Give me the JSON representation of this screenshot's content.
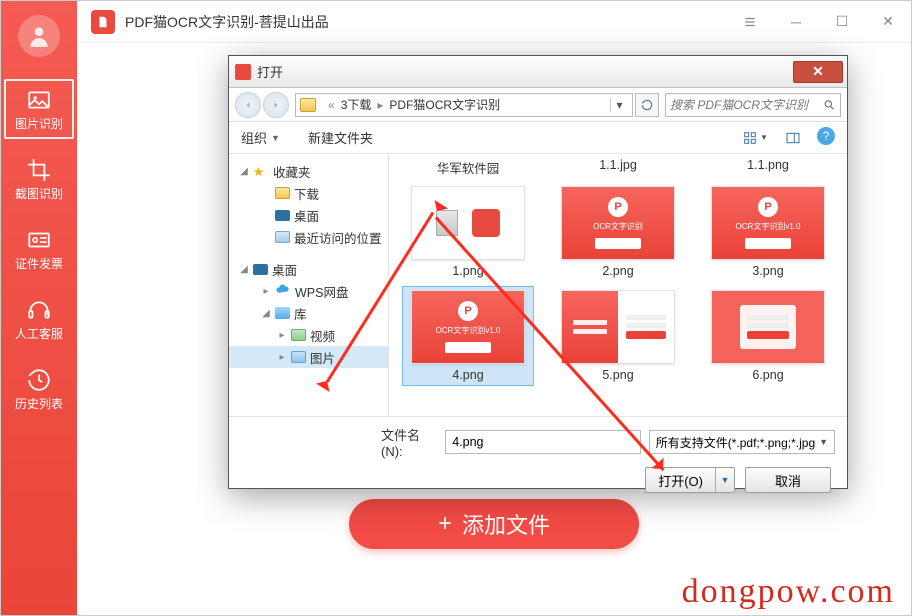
{
  "app": {
    "title": "PDF猫OCR文字识别-菩提山出品"
  },
  "sidebar": {
    "items": [
      {
        "label": "图片识别"
      },
      {
        "label": "截图识别"
      },
      {
        "label": "证件发票"
      },
      {
        "label": "人工客服"
      },
      {
        "label": "历史列表"
      }
    ]
  },
  "main": {
    "add_file_label": "添加文件"
  },
  "dialog": {
    "title": "打开",
    "breadcrumb": {
      "seg1": "3下载",
      "seg2": "PDF猫OCR文字识别"
    },
    "search_placeholder": "搜索 PDF猫OCR文字识别",
    "toolbar": {
      "organize": "组织",
      "new_folder": "新建文件夹"
    },
    "tree": {
      "favorites": "收藏夹",
      "downloads": "下载",
      "desktop_fav": "桌面",
      "recent": "最近访问的位置",
      "desktop": "桌面",
      "wps": "WPS网盘",
      "libraries": "库",
      "videos": "视频",
      "pictures": "图片"
    },
    "top_labels": {
      "a": "华军软件园",
      "b": "1.1.jpg",
      "c": "1.1.png"
    },
    "files": [
      {
        "name": "1.png"
      },
      {
        "name": "2.png"
      },
      {
        "name": "3.png"
      },
      {
        "name": "4.png"
      },
      {
        "name": "5.png"
      },
      {
        "name": "6.png"
      }
    ],
    "filename_label": "文件名(N):",
    "filename_value": "4.png",
    "filter_label": "所有支持文件(*.pdf;*.png;*.jpg",
    "open_btn": "打开(O)",
    "cancel_btn": "取消"
  },
  "watermark": "dongpow.com"
}
